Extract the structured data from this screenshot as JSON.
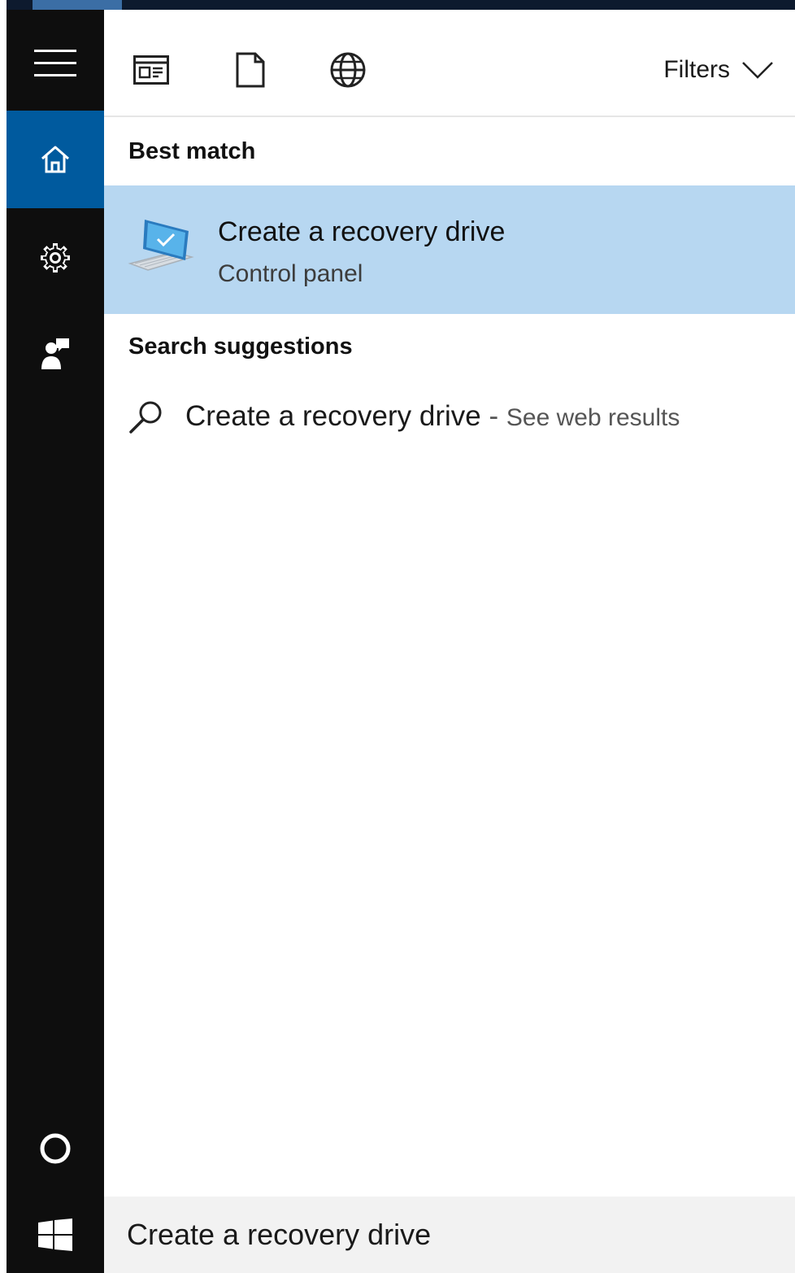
{
  "sidebar": {
    "items": [
      {
        "name": "menu",
        "icon": "hamburger-icon"
      },
      {
        "name": "home",
        "icon": "home-icon",
        "active": true
      },
      {
        "name": "settings",
        "icon": "gear-icon"
      },
      {
        "name": "feedback",
        "icon": "feedback-icon"
      },
      {
        "name": "cortana",
        "icon": "cortana-circle-icon"
      },
      {
        "name": "start",
        "icon": "windows-logo-icon"
      }
    ],
    "colors": {
      "background": "#0e0e0e",
      "active": "#005a9e"
    }
  },
  "toolbar": {
    "scopes": [
      {
        "name": "apps",
        "icon": "apps-icon"
      },
      {
        "name": "documents",
        "icon": "document-icon"
      },
      {
        "name": "web",
        "icon": "globe-icon"
      }
    ],
    "filters_label": "Filters",
    "filters_icon": "chevron-down-icon"
  },
  "best_match": {
    "header": "Best match",
    "title": "Create a recovery drive",
    "subtitle": "Control panel",
    "icon": "recovery-drive-icon",
    "highlight_color": "#b7d7f1"
  },
  "suggestions": {
    "header": "Search suggestions",
    "items": [
      {
        "query": "Create a recovery drive",
        "separator": " - ",
        "action": "See web results",
        "icon": "search-icon"
      }
    ]
  },
  "search": {
    "value": "Create a recovery drive"
  }
}
